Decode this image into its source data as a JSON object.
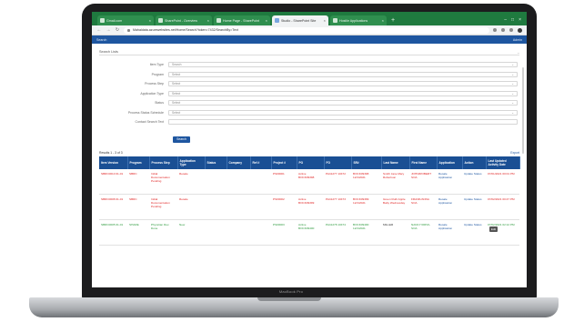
{
  "device": {
    "brand": "MacBook Pro"
  },
  "browser": {
    "tabs": [
      {
        "label": "Gmail.com",
        "active": false
      },
      {
        "label": "SharePoint - Overview",
        "active": false
      },
      {
        "label": "Home Page - SharePoint",
        "active": false
      },
      {
        "label": "Studio - SharePoint Site",
        "active": true
      },
      {
        "label": "Hostile Applications",
        "active": false
      }
    ],
    "address": "Mahaldata.azurewebsites.net/Home/Search?token=7432/SearchBy=Text",
    "icons": [
      "star-icon",
      "extensions-icon",
      "profile-icon",
      "menu-icon"
    ]
  },
  "app": {
    "title": "Search",
    "user": "Admin"
  },
  "search": {
    "section_title": "Search Lists",
    "fields": [
      {
        "label": "Item Type",
        "value": "Search"
      },
      {
        "label": "Program",
        "value": "Select"
      },
      {
        "label": "Process Step",
        "value": "Select"
      },
      {
        "label": "Application Type",
        "value": "Select"
      },
      {
        "label": "Status",
        "value": "Select"
      },
      {
        "label": "Process Status Schedule",
        "value": "Select"
      },
      {
        "label": "Contact Search Text",
        "value": ""
      }
    ],
    "button_label": "Search"
  },
  "results": {
    "count_text": "Results 1 - 3 of 3",
    "export_label": "Export",
    "columns": [
      "Item Version",
      "Program",
      "Process Step",
      "Application Type",
      "Status",
      "Company",
      "Ref #",
      "Project #",
      "PO",
      "FO",
      "SR#",
      "Last Name",
      "First Name",
      "Application",
      "Action",
      "Last Updated Activity Date"
    ],
    "rows": [
      {
        "tone": "red",
        "cells": [
          "SBRC0010 01-01",
          "SBRC",
          "Initial Documentation Pending",
          "Resale",
          "",
          "",
          "",
          "PS00001",
          "Active BOCK09398",
          "PA41277 10472",
          "BOCK09398 12/1/2021",
          "Smith Jane Mary Robertson",
          "JOHN/ROBERT SOA",
          "Resale Application",
          "Update Status",
          "07/01/2021 00:01 PM"
        ]
      },
      {
        "tone": "red",
        "cells": [
          "SBRC0008 01-01",
          "SBRC",
          "Initial Documentation Pending",
          "Resale",
          "",
          "",
          "",
          "PS00002",
          "Active BOCK09399",
          "PA41277 10473",
          "BOCK09399 12/1/2021",
          "Green Ruth Apple Baby Wednesday",
          "FRANK/ANNA SOA",
          "Resale Application",
          "Update Status",
          "07/02/2021 00:47 PM"
        ]
      },
      {
        "tone": "green",
        "cells": [
          "SBRC0005 01-01",
          "SHARE",
          "Physician Rev. Done",
          "New",
          "",
          "",
          "",
          "PS00003",
          "Active BOCK09400",
          "PA41278 10474",
          "BOCK09400 12/1/2021",
          "MILLER",
          "NANCY/ORVIL SOA",
          "Resale Application",
          "Update Status",
          "07/02/2021 02:12 PM"
        ]
      }
    ],
    "row_action_label": "Edit"
  },
  "colors": {
    "tab_strip": "#1f7a3f",
    "app_header": "#1e56a0",
    "table_header": "#1a4f94",
    "warning_row": "#e02424",
    "ok_row": "#2e9a3e"
  }
}
